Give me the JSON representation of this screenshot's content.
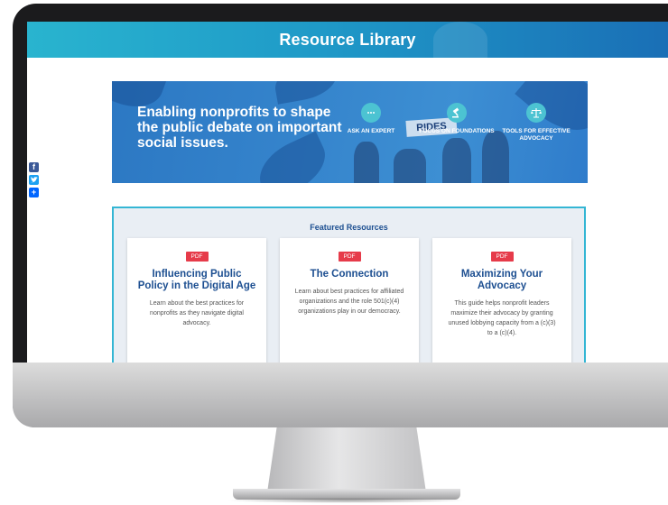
{
  "header": {
    "title": "Resource Library"
  },
  "social": {
    "facebook": "f",
    "twitter": "t",
    "share": "+"
  },
  "banner": {
    "tagline": "Enabling nonprofits to shape the public debate on important social issues.",
    "sign": "RIDES",
    "features": [
      {
        "label": "ASK AN EXPERT",
        "icon": "chat-icon"
      },
      {
        "label": "FOCUS ON FOUNDATIONS",
        "icon": "gavel-icon"
      },
      {
        "label": "TOOLS FOR EFFECTIVE ADVOCACY",
        "icon": "scale-icon"
      }
    ]
  },
  "featured": {
    "title": "Featured Resources",
    "cards": [
      {
        "badge": "PDF",
        "title": "Influencing Public Policy in the Digital Age",
        "desc": "Learn about the best practices for nonprofits as they navigate digital advocacy."
      },
      {
        "badge": "PDF",
        "title": "The Connection",
        "desc": "Learn about best practices for affiliated organizations and the role 501(c)(4) organizations play in our democracy."
      },
      {
        "badge": "PDF",
        "title": "Maximizing Your Advocacy",
        "desc": "This guide helps nonprofit leaders maximize their advocacy by granting unused lobbying capacity from a (c)(3) to a (c)(4)."
      }
    ]
  },
  "colors": {
    "header_start": "#29b4cf",
    "header_end": "#1a6fb6",
    "title_blue": "#1d4f91",
    "badge_red": "#e63b4a",
    "accent_teal": "#34b6d4"
  }
}
